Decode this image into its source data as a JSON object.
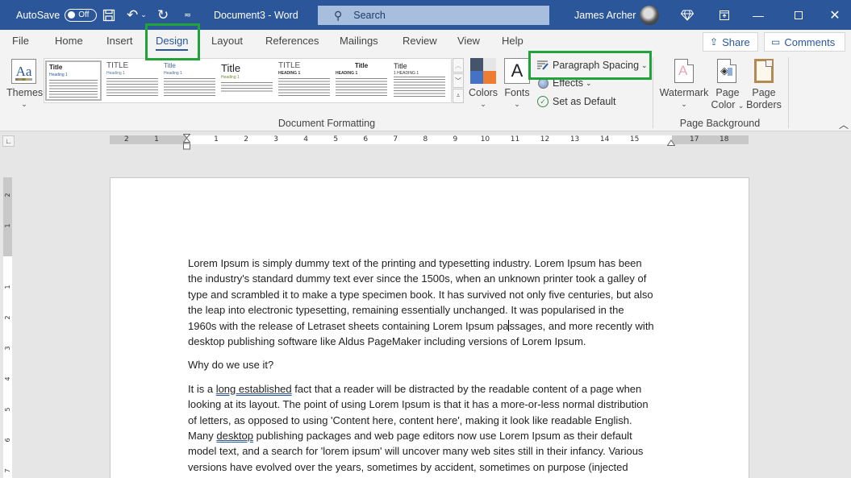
{
  "titlebar": {
    "autosave_label": "AutoSave",
    "autosave_state": "Off",
    "doc_title": "Document3  -  Word",
    "search_placeholder": "Search",
    "user_name": "James Archer"
  },
  "tabs": [
    {
      "label": "File"
    },
    {
      "label": "Home"
    },
    {
      "label": "Insert"
    },
    {
      "label": "Design",
      "active": true
    },
    {
      "label": "Layout"
    },
    {
      "label": "References"
    },
    {
      "label": "Mailings"
    },
    {
      "label": "Review"
    },
    {
      "label": "View"
    },
    {
      "label": "Help"
    }
  ],
  "share_label": "Share",
  "comments_label": "Comments",
  "ribbon": {
    "themes_label": "Themes",
    "themes_icon_text": "Aa",
    "gallery": [
      {
        "title": "Title",
        "heading": "Heading 1"
      },
      {
        "title": "TITLE",
        "heading": "Heading 1"
      },
      {
        "title": "Title",
        "heading": "Heading 1"
      },
      {
        "title": "Title",
        "heading": "Heading 1"
      },
      {
        "title": "TITLE",
        "heading": "HEADING 1"
      },
      {
        "title": "Title",
        "heading": "HEADING 1"
      },
      {
        "title": "Title",
        "heading": "1   HEADING 1"
      }
    ],
    "colors_label": "Colors",
    "fonts_label": "Fonts",
    "fonts_icon_text": "A",
    "paragraph_spacing_label": "Paragraph Spacing",
    "effects_label": "Effects",
    "set_default_label": "Set as Default",
    "group_document_formatting": "Document Formatting",
    "watermark_label": "Watermark",
    "page_color_label_1": "Page",
    "page_color_label_2": "Color",
    "page_borders_label_1": "Page",
    "page_borders_label_2": "Borders",
    "group_page_background": "Page Background",
    "theme_colors": [
      "#44546a",
      "#e7e6e6",
      "#4472c4",
      "#ed7d31"
    ]
  },
  "ruler": {
    "horizontal_ticks": [
      "2",
      "1",
      "1",
      "2",
      "3",
      "4",
      "5",
      "6",
      "7",
      "8",
      "9",
      "10",
      "11",
      "12",
      "13",
      "14",
      "15",
      "17",
      "18"
    ],
    "vertical_ticks": [
      "2",
      "1",
      "1",
      "2",
      "3",
      "4",
      "5",
      "6",
      "7"
    ]
  },
  "document": {
    "para1_lines": [
      "Lorem Ipsum is simply dummy text of the printing and typesetting industry. Lorem Ipsum has been",
      "the industry's standard dummy text ever since the 1500s, when an unknown printer took a galley of",
      "type and scrambled it to make a type specimen book. It has survived not only five centuries, but also",
      "the leap into electronic typesetting, remaining essentially unchanged. It was popularised in the"
    ],
    "para1_line5_before_caret": "1960s with the release of Letraset sheets containing Lorem Ipsum pa",
    "para1_line5_after_caret": "ssages, and more recently with",
    "para1_line6": "desktop publishing software like Aldus PageMaker including versions of Lorem Ipsum.",
    "heading": "Why do we use it?",
    "para2_line1_a": "It is a ",
    "para2_line1_u": "long established",
    "para2_line1_b": " fact that a reader will be distracted by the readable content of a page when",
    "para2_line2": "looking at its layout. The point of using Lorem Ipsum is that it has a more-or-less normal distribution",
    "para2_line3": "of letters, as opposed to using 'Content here, content here', making it look like readable English.",
    "para2_line4_a": "Many ",
    "para2_line4_u": "desktop",
    "para2_line4_b": " publishing packages and web page editors now use Lorem Ipsum as their default",
    "para2_line5": "model text, and a search for 'lorem ipsum' will uncover many web sites still in their infancy. Various",
    "para2_line6": "versions have evolved over the years, sometimes by accident, sometimes on purpose (injected"
  }
}
